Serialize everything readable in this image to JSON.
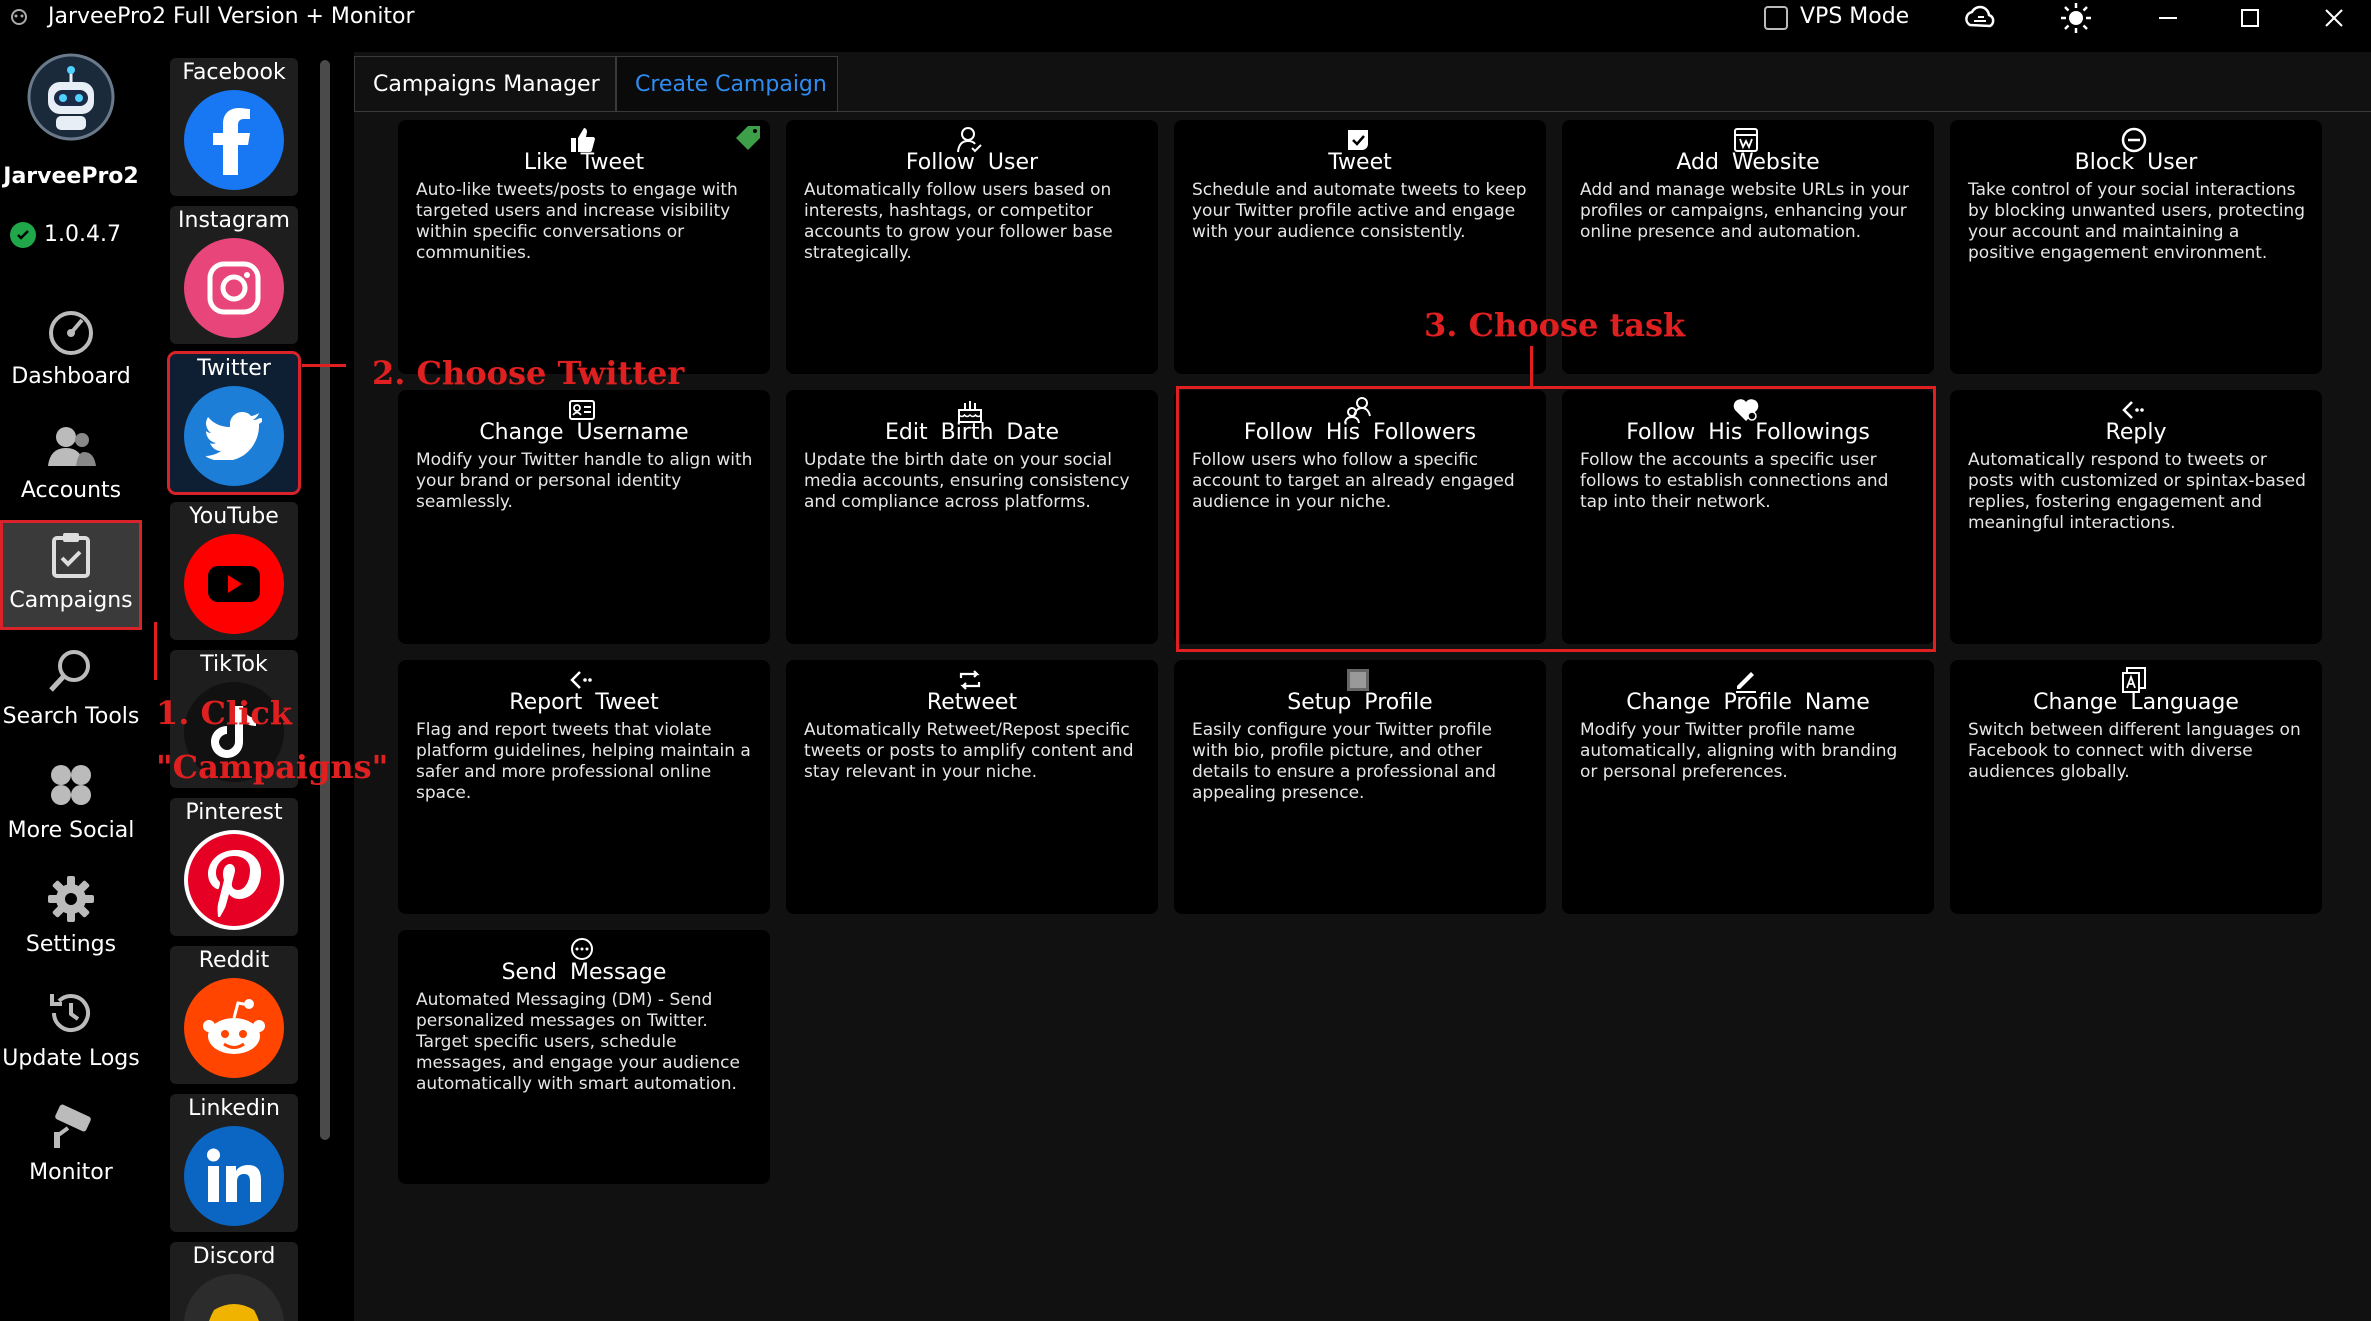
{
  "window": {
    "title": "JarveePro2 Full Version + Monitor",
    "vps_mode_label": "VPS Mode",
    "vps_mode_checked": false
  },
  "sidebar": {
    "brand": "JarveePro2",
    "version": "1.0.4.7",
    "items": [
      {
        "label": "Dashboard",
        "icon": "dashboard-icon"
      },
      {
        "label": "Accounts",
        "icon": "accounts-icon"
      },
      {
        "label": "Campaigns",
        "icon": "campaigns-icon",
        "active": true
      },
      {
        "label": "Search Tools",
        "icon": "search-icon"
      },
      {
        "label": "More Social",
        "icon": "more-social-icon"
      },
      {
        "label": "Settings",
        "icon": "gear-icon"
      },
      {
        "label": "Update Logs",
        "icon": "update-logs-icon"
      },
      {
        "label": "Monitor",
        "icon": "monitor-icon"
      }
    ]
  },
  "social": [
    {
      "label": "Facebook",
      "icon": "facebook-icon",
      "color": "#1877f2"
    },
    {
      "label": "Instagram",
      "icon": "instagram-icon",
      "color": "#e1306c"
    },
    {
      "label": "Twitter",
      "icon": "twitter-icon",
      "color": "#1d7ed8",
      "selected": true
    },
    {
      "label": "YouTube",
      "icon": "youtube-icon",
      "color": "#ff0000"
    },
    {
      "label": "TikTok",
      "icon": "tiktok-icon",
      "color": "#111111"
    },
    {
      "label": "Pinterest",
      "icon": "pinterest-icon",
      "color": "#e60023"
    },
    {
      "label": "Reddit",
      "icon": "reddit-icon",
      "color": "#ff4500"
    },
    {
      "label": "Linkedin",
      "icon": "linkedin-icon",
      "color": "#0a66c2"
    },
    {
      "label": "Discord",
      "icon": "discord-icon",
      "color": "#f0b400"
    }
  ],
  "tabs": [
    {
      "label": "Campaigns Manager"
    },
    {
      "label": "Create Campaign",
      "selected": true
    }
  ],
  "tasks": [
    {
      "title": "Like Tweet",
      "icon": "thumbs-up-icon",
      "free": true,
      "desc": "Auto-like tweets/posts to engage with targeted users and increase visibility within specific conversations or communities."
    },
    {
      "title": "Follow User",
      "icon": "follow-user-icon",
      "desc": "Automatically follow users based on interests, hashtags, or competitor accounts to grow your follower base strategically."
    },
    {
      "title": "Tweet",
      "icon": "tweet-icon",
      "desc": "Schedule and automate tweets to keep your Twitter profile active and engage with your audience consistently."
    },
    {
      "title": "Add Website",
      "icon": "website-icon",
      "desc": "Add and manage website URLs in your profiles or campaigns, enhancing your online presence and automation."
    },
    {
      "title": "Block User",
      "icon": "block-icon",
      "desc": "Take control of your social interactions by blocking unwanted users, protecting your account and maintaining a positive engagement environment."
    },
    {
      "title": "Change Username",
      "icon": "id-card-icon",
      "desc": "Modify your Twitter handle to align with your brand or personal identity seamlessly."
    },
    {
      "title": "Edit Birth Date",
      "icon": "cake-icon",
      "desc": "Update the birth date on your social media accounts, ensuring consistency and compliance across platforms."
    },
    {
      "title": "Follow His Followers",
      "icon": "followers-icon",
      "desc": "Follow users who follow a specific account to target an already engaged audience in your niche."
    },
    {
      "title": "Follow His Followings",
      "icon": "heart-user-icon",
      "desc": "Follow the accounts a specific user follows to establish connections and tap into their network."
    },
    {
      "title": "Reply",
      "icon": "reply-icon",
      "desc": "Automatically respond to tweets or posts with customized or spintax-based replies, fostering engagement and meaningful interactions."
    },
    {
      "title": "Report Tweet",
      "icon": "report-icon",
      "desc": "Flag and report tweets that violate platform guidelines, helping maintain a safer and more professional online space."
    },
    {
      "title": "Retweet",
      "icon": "retweet-icon",
      "desc": "Automatically Retweet/Repost specific tweets or posts to amplify content and stay relevant in your niche."
    },
    {
      "title": "Setup Profile",
      "icon": "profile-icon",
      "desc": "Easily configure your Twitter profile with bio, profile picture, and other details to ensure a professional and appealing presence."
    },
    {
      "title": "Change Profile Name",
      "icon": "pencil-icon",
      "desc": "Modify your Twitter profile name automatically, aligning with branding or personal preferences."
    },
    {
      "title": "Change Language",
      "icon": "language-icon",
      "desc": "Switch between different languages on Facebook to connect with diverse audiences globally."
    },
    {
      "title": "Send Message",
      "icon": "message-icon",
      "desc": "Automated Messaging (DM) - Send personalized messages on Twitter. Target specific users, schedule messages, and engage your audience automatically with smart automation."
    }
  ],
  "annotations": {
    "step1_line1": "1. Click",
    "step1_line2": "\"Campaigns\"",
    "step2": "2. Choose Twitter",
    "step3": "3. Choose task"
  },
  "colors": {
    "accent": "#2f8df2",
    "annotation": "#e02020",
    "card_bg": "#000000",
    "panel_bg": "#111111"
  }
}
